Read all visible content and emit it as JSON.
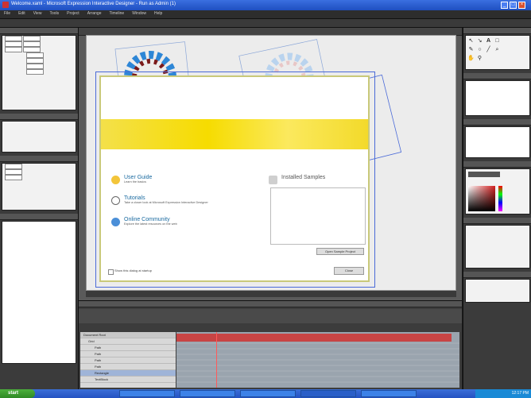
{
  "window": {
    "title": "Welcome.xaml - Microsoft Expression Interactive Designer - Run as Admin (1)",
    "controls": [
      "_",
      "□",
      "×"
    ]
  },
  "menu": [
    "File",
    "Edit",
    "View",
    "Tools",
    "Project",
    "Arrange",
    "Timeline",
    "Window",
    "Help"
  ],
  "dialog": {
    "items": [
      {
        "label": "User Guide",
        "sub": "Learn the basics"
      },
      {
        "label": "Tutorials",
        "sub": "Take a closer look at Microsoft Expression Interactive Designer"
      },
      {
        "label": "Online Community",
        "sub": "Explore the latest resources on the web"
      },
      {
        "label": "Installed Samples",
        "sub": ""
      }
    ],
    "close": "Close",
    "checkbox": "Show this dialog at startup",
    "open_samples": "Open Sample Project"
  },
  "layers": [
    "Document Root",
    "Grid",
    "Path",
    "Path",
    "Path",
    "Path",
    "Rectangle",
    "TextBlock"
  ],
  "taskbar": {
    "start": "start",
    "clock": "12:17 PM"
  },
  "colors": {
    "accent": "#f6dc00",
    "selection": "#4a6ad8",
    "timeline_red": "#c84444"
  }
}
